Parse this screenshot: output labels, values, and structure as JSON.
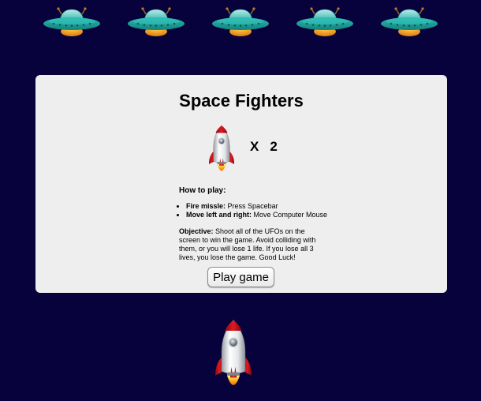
{
  "game": {
    "title": "Space Fighters",
    "lives_multiplier": "X",
    "lives_count": "2"
  },
  "enemies": {
    "ufo_count": 5,
    "icon": "ufo-icon"
  },
  "instructions": {
    "heading": "How to play:",
    "controls": [
      {
        "label": "Fire missle:",
        "text": "Press Spacebar"
      },
      {
        "label": "Move left and right:",
        "text": "Move Computer Mouse"
      }
    ],
    "objective_label": "Objective:",
    "objective_text": "Shoot all of the UFOs on the screen to win the game. Avoid colliding with them, or you will lose 1 life. If you lose all 3 lives, you lose the game. Good Luck!"
  },
  "actions": {
    "play_label": "Play game"
  },
  "player": {
    "icon": "rocket-icon"
  },
  "colors": {
    "background": "#07023b",
    "panel": "#eeeeee",
    "ufo_body": "#1ba39c",
    "ufo_dome": "#7fd7d3",
    "ufo_glow": "#f0a020",
    "rocket_fin": "#d8141b",
    "rocket_flame": "#f7b21a"
  }
}
